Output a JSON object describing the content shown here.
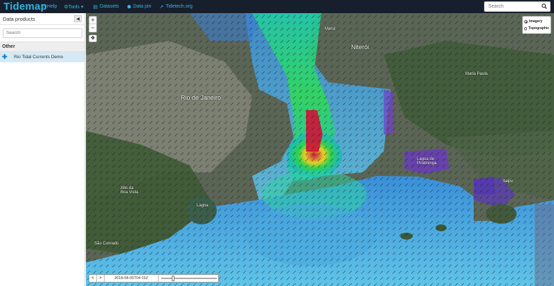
{
  "navbar": {
    "brand": "Tidemap",
    "links": [
      {
        "icon": "help-icon",
        "glyph": "?",
        "label": "Help"
      },
      {
        "icon": "gear-icon",
        "glyph": "⚙",
        "label": "Tools ▾"
      },
      {
        "icon": "datasets-icon",
        "glyph": "▤",
        "label": "Datasets"
      },
      {
        "icon": "pin-icon",
        "glyph": "⬤",
        "label": "Data pin"
      },
      {
        "icon": "external-link-icon",
        "glyph": "↗",
        "label": "Tidetech.org"
      }
    ],
    "search_placeholder": "Search"
  },
  "sidebar": {
    "title": "Data products",
    "collapse_glyph": "◀",
    "search_placeholder": "Search",
    "group": "Other",
    "product": "Rio Tidal Currents Demo"
  },
  "map": {
    "zoom_in": "+",
    "zoom_out": "−",
    "locate_glyph": "✥",
    "layers": [
      {
        "label": "Imagery",
        "selected": true
      },
      {
        "label": "Topographic",
        "selected": false
      }
    ],
    "labels": [
      {
        "text": "Niterói"
      },
      {
        "text": "Rio de Janeiro"
      },
      {
        "text": "Lagoa de Piratininga"
      },
      {
        "text": "Alto da Boa Vista"
      },
      {
        "text": "Lagoa"
      },
      {
        "text": "São Conrado"
      },
      {
        "text": "Maruí"
      },
      {
        "text": "Maria Paula"
      },
      {
        "text": "Itaipu"
      }
    ]
  },
  "timebar": {
    "prev": "<",
    "next": ">",
    "time": "2018-08-05T04:15Z",
    "slider_fraction": 0.2
  },
  "colors": {
    "navbar_bg": "#171f2c",
    "brand": "#2fb3e0",
    "selected_row": "#d6e9f5"
  }
}
